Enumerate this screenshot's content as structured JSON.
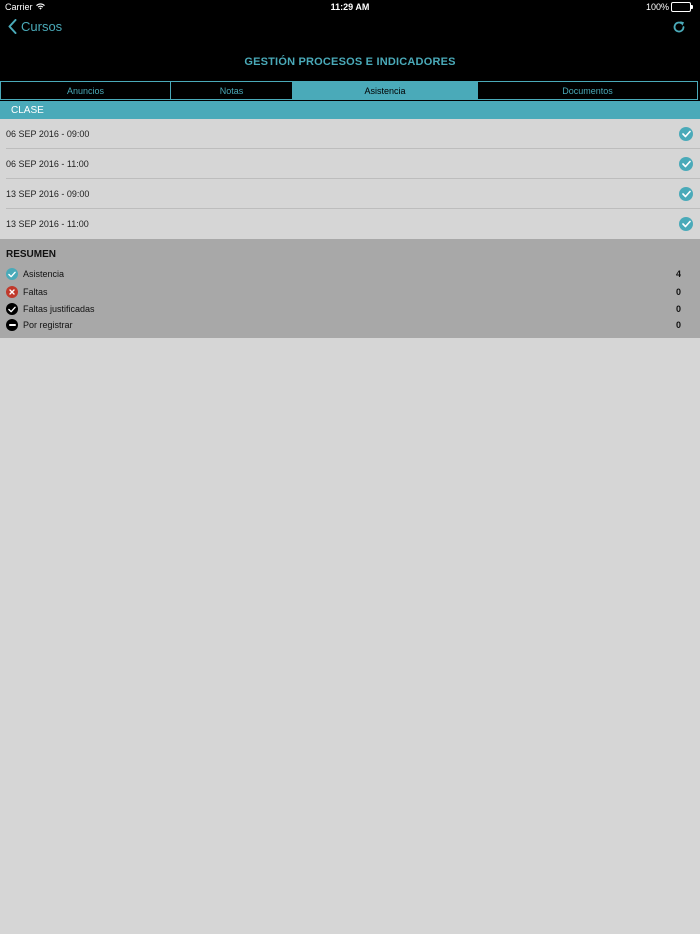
{
  "status_bar": {
    "carrier": "Carrier",
    "time": "11:29 AM",
    "battery": "100%"
  },
  "nav": {
    "back_label": "Cursos",
    "title": "GESTIÓN PROCESOS E INDICADORES"
  },
  "tabs": [
    {
      "label": "Anuncios",
      "active": false
    },
    {
      "label": "Notas",
      "active": false
    },
    {
      "label": "Asistencia",
      "active": true
    },
    {
      "label": "Documentos",
      "active": false
    }
  ],
  "section": {
    "header": "CLASE"
  },
  "classes": [
    {
      "label": "06 SEP 2016 - 09:00",
      "status": "asistencia"
    },
    {
      "label": "06 SEP 2016 - 11:00",
      "status": "asistencia"
    },
    {
      "label": "13 SEP 2016 - 09:00",
      "status": "asistencia"
    },
    {
      "label": "13 SEP 2016 - 11:00",
      "status": "asistencia"
    }
  ],
  "summary": {
    "title": "RESUMEN",
    "rows": [
      {
        "label": "Asistencia",
        "value": "4",
        "icon": "check-circle-icon",
        "color": "#4aaab9"
      },
      {
        "label": "Faltas",
        "value": "0",
        "icon": "x-circle-icon",
        "color": "#c0392b"
      },
      {
        "label": "Faltas justificadas",
        "value": "0",
        "icon": "check-circle-dark-icon",
        "color": "#000000"
      },
      {
        "label": "Por registrar",
        "value": "0",
        "icon": "minus-circle-icon",
        "color": "#000000"
      }
    ]
  },
  "colors": {
    "accent": "#4aaab9",
    "background": "#d6d6d6",
    "summary_bg": "#a8a8a8"
  }
}
